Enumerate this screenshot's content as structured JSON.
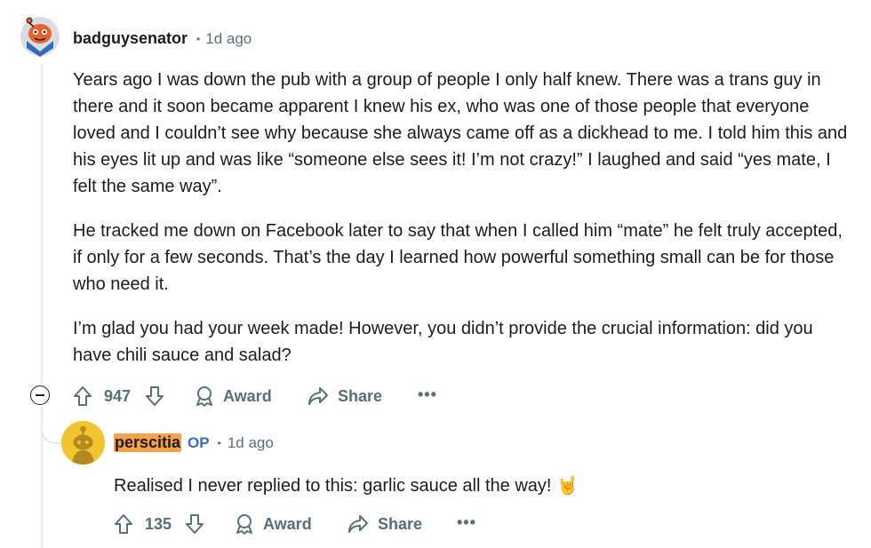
{
  "comment": {
    "author": "badguysenator",
    "separator": "•",
    "time": "1d ago",
    "paragraphs": [
      "Years ago I was down the pub with a group of people I only half knew. There was a trans guy in there and it soon became apparent I knew his ex, who was one of those people that everyone loved and I couldn’t see why because she always came off as a dickhead to me. I told him this and his eyes lit up and was like “someone else sees it! I’m not crazy!” I laughed and said “yes mate, I felt the same way”.",
      "He tracked me down on Facebook later to say that when I called him “mate” he felt truly accepted, if only for a few seconds. That’s the day I learned how powerful something small can be for those who need it.",
      "I’m glad you had your week made! However, you didn’t provide the crucial information: did you have chili sauce and salad?"
    ],
    "votes": "947",
    "award_label": "Award",
    "share_label": "Share",
    "more_label": "•••"
  },
  "reply": {
    "author": "perscitia",
    "op_badge": "OP",
    "separator": "•",
    "time": "1d ago",
    "text": "Realised I never replied to this: garlic sauce all the way! 🤘",
    "votes": "135",
    "award_label": "Award",
    "share_label": "Share",
    "more_label": "•••"
  },
  "icons": {
    "collapse": "minus-circle-icon",
    "upvote": "arrow-up-icon",
    "downvote": "arrow-down-icon",
    "award": "award-icon",
    "share": "share-icon",
    "more": "more-horizontal-icon"
  },
  "colors": {
    "text": "#1c1c1c",
    "meta": "#576f76",
    "op_badge": "#3a6bbf",
    "op_highlight": "#f5a04a",
    "thread_line": "#e2e7ea"
  }
}
